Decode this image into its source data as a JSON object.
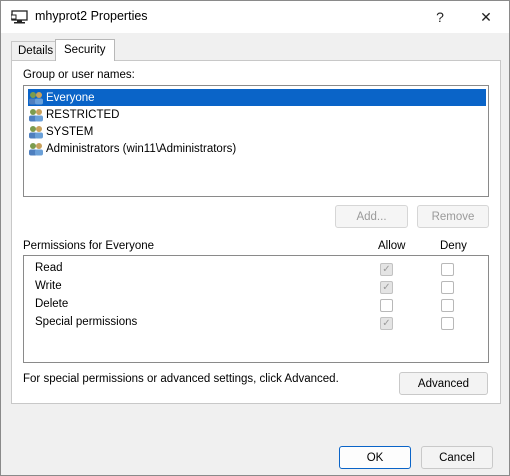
{
  "window": {
    "title": "mhyprot2 Properties",
    "help": "?",
    "close": "✕"
  },
  "tabs": [
    {
      "label": "Details",
      "active": false
    },
    {
      "label": "Security",
      "active": true
    }
  ],
  "security": {
    "group_label": "Group or user names:",
    "users": [
      {
        "name": "Everyone",
        "selected": true
      },
      {
        "name": "RESTRICTED",
        "selected": false
      },
      {
        "name": "SYSTEM",
        "selected": false
      },
      {
        "name": "Administrators (win11\\Administrators)",
        "selected": false
      }
    ],
    "add_button": "Add...",
    "remove_button": "Remove",
    "permissions_label": "Permissions for Everyone",
    "allow_header": "Allow",
    "deny_header": "Deny",
    "permissions": [
      {
        "name": "Read",
        "allow": true,
        "deny": false
      },
      {
        "name": "Write",
        "allow": true,
        "deny": false
      },
      {
        "name": "Delete",
        "allow": false,
        "deny": false
      },
      {
        "name": "Special permissions",
        "allow": true,
        "deny": false
      }
    ],
    "advanced_text": "For special permissions or advanced settings, click Advanced.",
    "advanced_button": "Advanced"
  },
  "footer": {
    "ok": "OK",
    "cancel": "Cancel"
  },
  "colors": {
    "selection": "#0a64c8",
    "window_bg": "#f0f0f0"
  }
}
